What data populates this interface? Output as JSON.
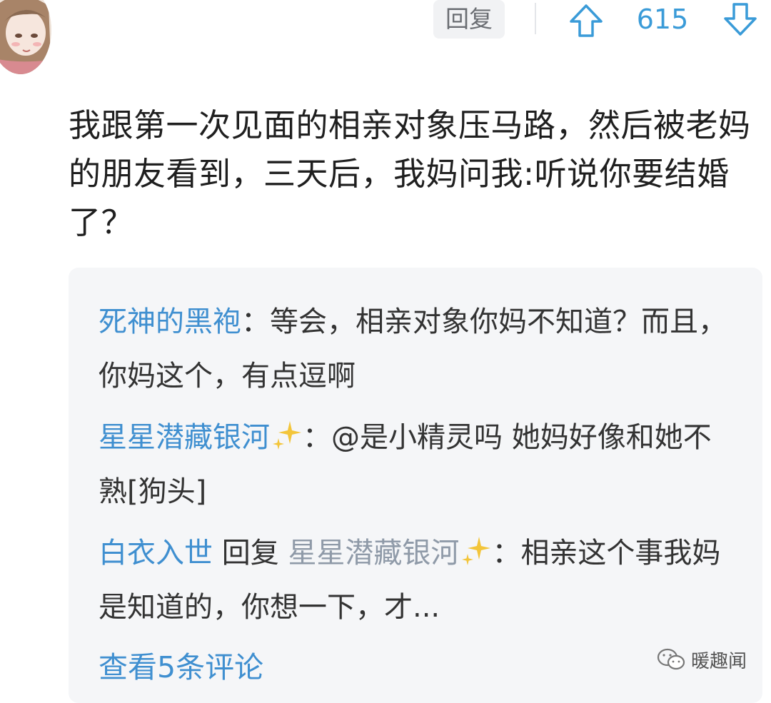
{
  "comment": {
    "reply_label": "回复",
    "vote_count": "615",
    "text": "我跟第一次见面的相亲对象压马路，然后被老妈的朋友看到，三天后，我妈问我:听说你要结婚了？"
  },
  "replies": [
    {
      "user": "死神的黑袍",
      "separator": "：",
      "text": "等会，相亲对象你妈不知道？而且，你妈这个，有点逗啊"
    },
    {
      "user": "星星潜藏银河",
      "separator": "：",
      "text": "@是小精灵吗 她妈好像和她不熟[狗头]"
    },
    {
      "user": "白衣入世",
      "reply_word": "回复",
      "target": "星星潜藏银河",
      "separator": "：",
      "text": "相亲这个事我妈是知道的，你想一下，才..."
    }
  ],
  "view_more": "查看5条评论",
  "watermark": "暖趣闻",
  "colors": {
    "accent": "#3f8fd0",
    "vote": "#3a9bd8",
    "reply_bg": "#f5f6f8"
  }
}
